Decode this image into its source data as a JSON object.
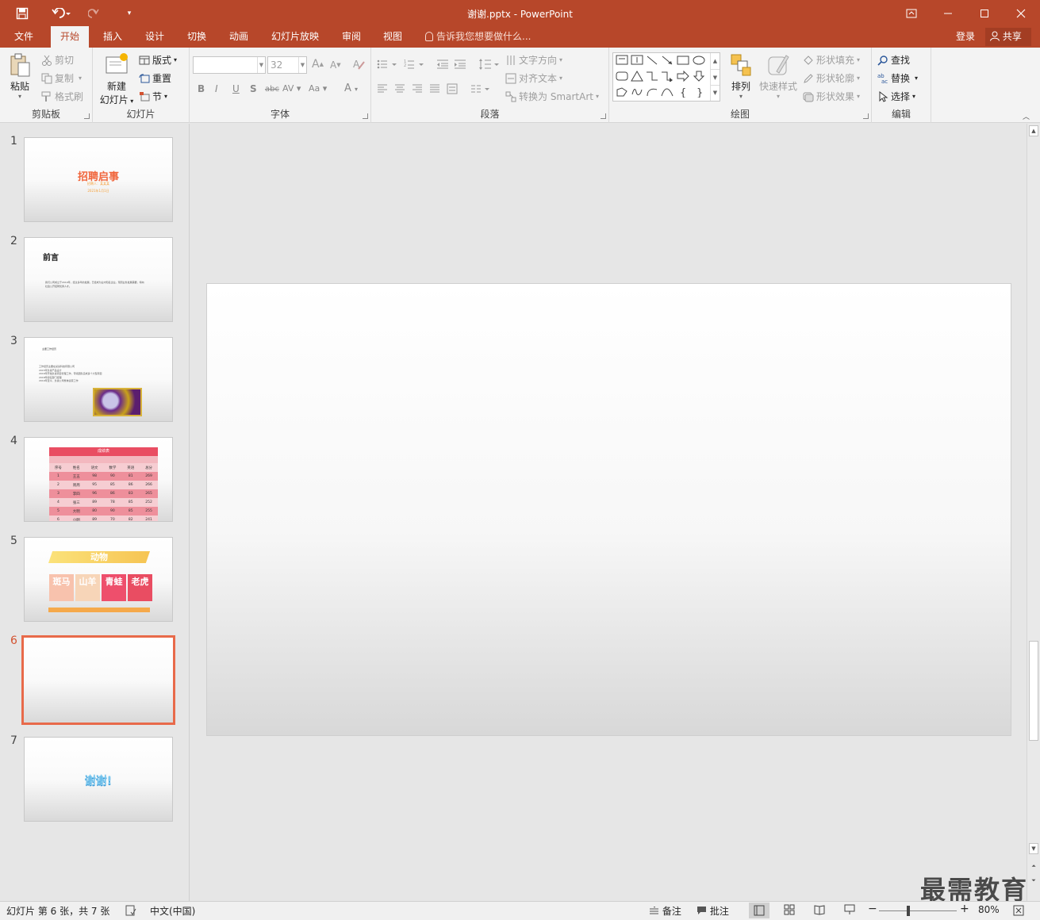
{
  "window": {
    "title": "谢谢.pptx - PowerPoint",
    "icons": [
      "save-icon",
      "undo-icon",
      "redo-icon",
      "customize-qat-icon",
      "ribbon-display-icon",
      "minimize-icon",
      "maximize-icon",
      "close-icon"
    ]
  },
  "tabs": [
    "文件",
    "开始",
    "插入",
    "设计",
    "切换",
    "动画",
    "幻灯片放映",
    "审阅",
    "视图"
  ],
  "active_tab": "开始",
  "tell_me": "告诉我您想要做什么...",
  "account": {
    "login": "登录",
    "share": "共享"
  },
  "ribbon": {
    "clipboard": {
      "label": "剪贴板",
      "paste": "粘贴",
      "cut": "剪切",
      "copy": "复制",
      "format_painter": "格式刷"
    },
    "slides": {
      "label": "幻灯片",
      "new_slide_1": "新建",
      "new_slide_2": "幻灯片",
      "layout": "版式",
      "reset": "重置",
      "section": "节"
    },
    "font": {
      "label": "字体",
      "font_name": "",
      "font_size": "32"
    },
    "paragraph": {
      "label": "段落",
      "text_direction": "文字方向",
      "align_text": "对齐文本",
      "smartart": "转换为 SmartArt"
    },
    "drawing": {
      "label": "绘图",
      "arrange": "排列",
      "quick_styles": "快速样式",
      "shape_fill": "形状填充",
      "shape_outline": "形状轮廓",
      "shape_effects": "形状效果"
    },
    "editing": {
      "label": "编辑",
      "find": "查找",
      "replace": "替换",
      "select": "选择"
    }
  },
  "slides": [
    {
      "num": "1",
      "title": "招聘启事",
      "subtitle": "招聘人：某某某",
      "date": "2021年1月1日"
    },
    {
      "num": "2",
      "title": "前言",
      "body": "我们公司成立于2010年，经过多年的发展，已经成为业内知名企业。现因业务发展需要，特向社会公开招聘优秀人才。"
    },
    {
      "num": "3",
      "title": "主要工作经历",
      "lines": [
        "工作经历主要在某某科技有限公司",
        "2015年负责产品设计",
        "2016年开始负责项目管理工作，带领团队完成多个大型项目",
        "2018年担任部门经理",
        "2019年至今，负责公司整体运营工作"
      ]
    },
    {
      "num": "4",
      "table_title": "成绩表",
      "headers": [
        "序号",
        "姓名",
        "语文",
        "数学",
        "英语",
        "总分"
      ],
      "rows": [
        [
          "1",
          "王五",
          "98",
          "90",
          "81",
          "269"
        ],
        [
          "2",
          "周周",
          "95",
          "85",
          "86",
          "266"
        ],
        [
          "3",
          "李四",
          "96",
          "86",
          "83",
          "265"
        ],
        [
          "4",
          "张三",
          "89",
          "78",
          "85",
          "252"
        ],
        [
          "5",
          "大明",
          "80",
          "90",
          "85",
          "255"
        ],
        [
          "6",
          "小明",
          "89",
          "70",
          "82",
          "241"
        ]
      ]
    },
    {
      "num": "5",
      "banner": "动物",
      "cards": [
        "斑马",
        "山羊",
        "青蛙",
        "老虎"
      ]
    },
    {
      "num": "6"
    },
    {
      "num": "7",
      "title": "谢谢!"
    }
  ],
  "selected_slide": "6",
  "watermark": "最需教育",
  "statusbar": {
    "slide_info": "幻灯片 第 6 张，共 7 张",
    "language": "中文(中国)",
    "notes": "备注",
    "comments": "批注",
    "zoom": "80%"
  },
  "colors": {
    "accent": "#b7472a",
    "selection": "#e86a4a"
  }
}
